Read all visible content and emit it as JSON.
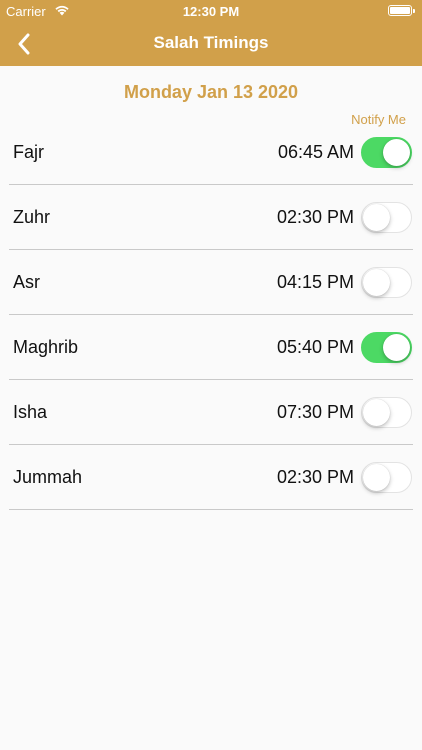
{
  "status_bar": {
    "carrier": "Carrier",
    "time": "12:30 PM"
  },
  "nav": {
    "title": "Salah Timings"
  },
  "date": "Monday Jan 13 2020",
  "notify_label": "Notify Me",
  "colors": {
    "accent": "#d1a04a",
    "toggle_on": "#4cd964"
  },
  "prayers": [
    {
      "name": "Fajr",
      "time": "06:45 AM",
      "notify": true
    },
    {
      "name": "Zuhr",
      "time": "02:30 PM",
      "notify": false
    },
    {
      "name": "Asr",
      "time": "04:15 PM",
      "notify": false
    },
    {
      "name": "Maghrib",
      "time": "05:40 PM",
      "notify": true
    },
    {
      "name": "Isha",
      "time": "07:30 PM",
      "notify": false
    },
    {
      "name": "Jummah",
      "time": "02:30 PM",
      "notify": false
    }
  ]
}
